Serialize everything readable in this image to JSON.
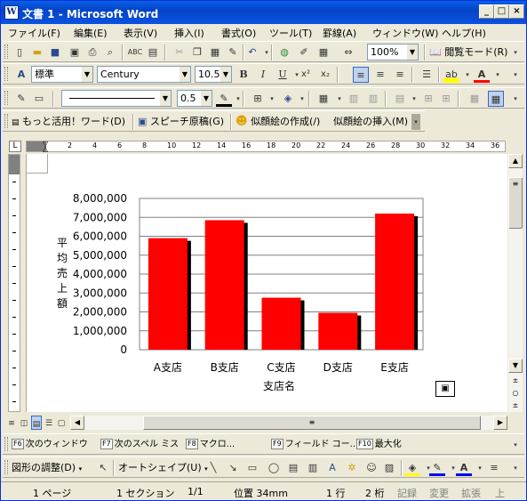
{
  "window": {
    "icon_label": "W",
    "title": "文書 1 - Microsoft Word",
    "controls": {
      "minimize": "_",
      "restore": "□",
      "close": "×"
    }
  },
  "menu": [
    "ファイル(F)",
    "編集(E)",
    "表示(V)",
    "挿入(I)",
    "書式(O)",
    "ツール(T)",
    "罫線(A)",
    "ウィンドウ(W)",
    "ヘルプ(H)"
  ],
  "standard_toolbar": {
    "zoom": "100%",
    "reading_mode": "閲覧モード(R)"
  },
  "format_toolbar": {
    "style": "標準",
    "font": "Century",
    "size": "10.5",
    "bold": "B",
    "italic": "I",
    "underline": "U",
    "superscript": "x²",
    "subscript": "x₂"
  },
  "drawing_line_toolbar": {
    "line_weight": "0.5"
  },
  "extra_toolbar": {
    "more_word": "もっと活用！ワード(D)",
    "speech": "スピーチ原稿(G)",
    "portrait_create": "似顔絵の作成(/)",
    "portrait_insert": "似顔絵の挿入(M)"
  },
  "ruler_ticks": [
    "2",
    "4",
    "6",
    "8",
    "10",
    "12",
    "14",
    "16",
    "18",
    "20",
    "22",
    "24",
    "26",
    "28",
    "30",
    "32",
    "34",
    "36"
  ],
  "chart_data": {
    "type": "bar",
    "categories": [
      "A支店",
      "B支店",
      "C支店",
      "D支店",
      "E支店"
    ],
    "values": [
      5900000,
      6850000,
      2750000,
      1950000,
      7200000
    ],
    "xlabel": "支店名",
    "ylabel": "平均売上額",
    "ylabel_chars": [
      "平",
      "均",
      "売",
      "上",
      "額"
    ],
    "ylim": [
      0,
      8000000
    ],
    "yticks": [
      "0",
      "1,000,000",
      "2,000,000",
      "3,000,000",
      "4,000,000",
      "5,000,000",
      "6,000,000",
      "7,000,000",
      "8,000,000"
    ],
    "bar_color": "#ff0000",
    "grid": true,
    "legend": "none"
  },
  "function_keys": [
    {
      "key": "F6",
      "label": "次のウィンドウ"
    },
    {
      "key": "F7",
      "label": "次のスペル ミス"
    },
    {
      "key": "F8",
      "label": "マクロ..."
    },
    {
      "key": "F9",
      "label": "フィールド コー.."
    },
    {
      "key": "F10",
      "label": "最大化"
    }
  ],
  "drawing_toolbar": {
    "adjust": "図形の調整(D)",
    "autoshape": "オートシェイプ(U)"
  },
  "status": {
    "page": "1 ページ",
    "section": "1 セクション",
    "page_of": "1/1",
    "position": "位置 34mm",
    "line": "1 行",
    "column": "2 桁",
    "rec": "記録",
    "trk": "変更",
    "ext": "拡張",
    "ovr": "上"
  }
}
